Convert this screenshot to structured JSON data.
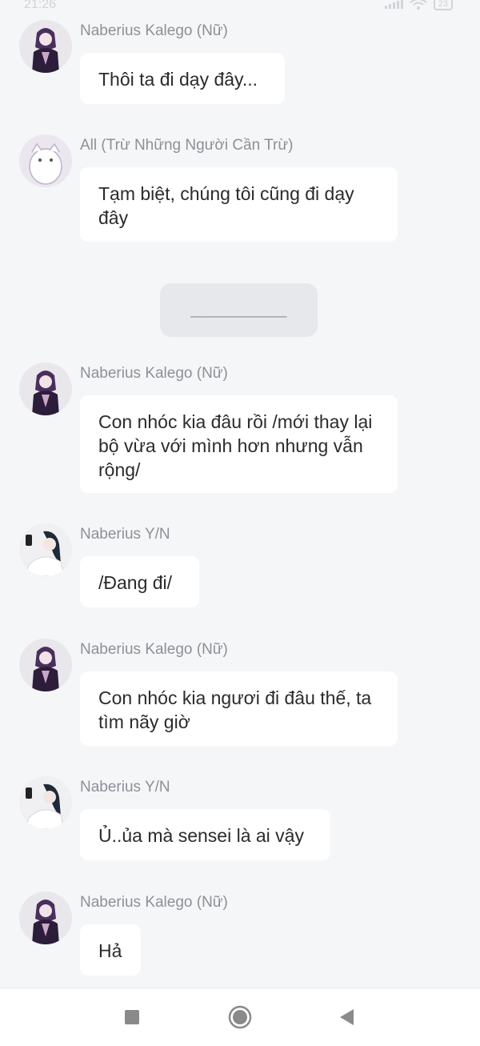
{
  "status_bar": {
    "time": "21:26",
    "battery": "23"
  },
  "messages": [
    {
      "sender": "Naberius Kalego (Nữ)",
      "text": "Thôi ta đi dạy đây...",
      "avatar": "kalego-avatar"
    },
    {
      "sender": "All (Trừ Những Người Cần Trừ)",
      "text": "Tạm biệt, chúng tôi cũng đi dạy đây",
      "avatar": "white-creature-avatar"
    },
    {
      "sender": "Naberius Kalego (Nữ)",
      "text": "Con nhóc kia đâu rồi /mới thay lại bộ vừa với mình hơn nhưng vẫn rộng/",
      "avatar": "kalego-avatar"
    },
    {
      "sender": "Naberius Y/N",
      "text": "/Đang đi/",
      "avatar": "yn-avatar"
    },
    {
      "sender": "Naberius Kalego (Nữ)",
      "text": "Con nhóc kia ngươi đi đâu thế, ta tìm nãy giờ",
      "avatar": "kalego-avatar"
    },
    {
      "sender": "Naberius Y/N",
      "text": "Ủ..ủa mà sensei là ai vậy",
      "avatar": "yn-avatar"
    },
    {
      "sender": "Naberius Kalego (Nữ)",
      "text": "Hả",
      "avatar": "kalego-avatar"
    }
  ],
  "divider": {
    "text": "____________"
  },
  "nav": {
    "icons": [
      "recent-apps-icon",
      "home-icon",
      "back-icon"
    ]
  },
  "colors": {
    "background": "#f5f6f8",
    "bubble": "#ffffff",
    "sender_text": "#8d9096",
    "message_text": "#2b2b2b",
    "nav_icons": "#8a8a8a"
  }
}
